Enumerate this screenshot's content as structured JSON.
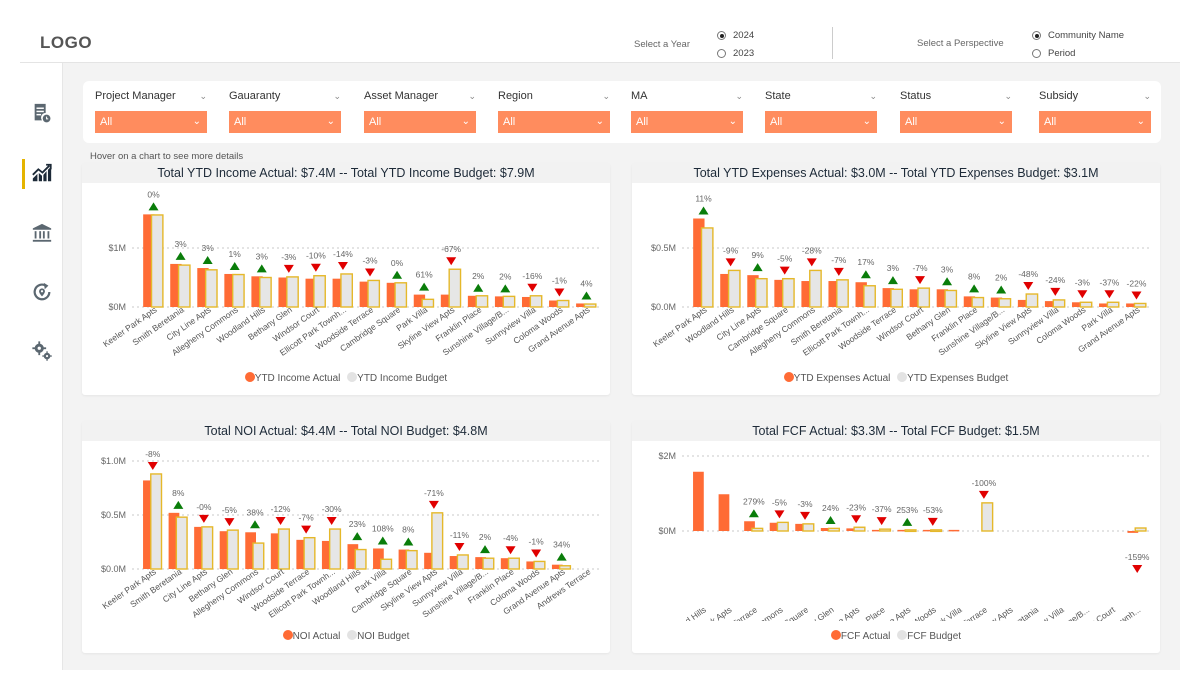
{
  "header": {
    "logo": "LOGO",
    "year_label": "Select a Year",
    "year_options": [
      {
        "label": "2024",
        "selected": true
      },
      {
        "label": "2023",
        "selected": false
      }
    ],
    "perspective_label": "Select a Perspective",
    "perspective_options": [
      {
        "label": "Community Name",
        "selected": true
      },
      {
        "label": "Period",
        "selected": false
      }
    ]
  },
  "sidebar": {
    "items": [
      {
        "icon": "report-icon",
        "active": false
      },
      {
        "icon": "trend-chart-icon",
        "active": true
      },
      {
        "icon": "bank-icon",
        "active": false
      },
      {
        "icon": "refresh-location-icon",
        "active": false
      },
      {
        "icon": "settings-gears-icon",
        "active": false
      }
    ]
  },
  "filters": [
    {
      "label": "Project Manager",
      "value": "All"
    },
    {
      "label": "Gauaranty",
      "value": "All"
    },
    {
      "label": "Asset Manager",
      "value": "All"
    },
    {
      "label": "Region",
      "value": "All"
    },
    {
      "label": "MA",
      "value": "All"
    },
    {
      "label": "State",
      "value": "All"
    },
    {
      "label": "Status",
      "value": "All"
    },
    {
      "label": "Subsidy",
      "value": "All"
    }
  ],
  "hover_hint": "Hover on a chart to see more details",
  "colors": {
    "actual": "#ff6b35",
    "budget_fill": "#e6e6e6",
    "budget_border": "#e5b82a",
    "up": "#0a7d0a",
    "down": "#e00000",
    "filter_bg": "#ff8c5e"
  },
  "chart_data": [
    {
      "type": "bar",
      "title": "Total YTD Income Actual: $7.4M -- Total YTD Income Budget: $7.9M",
      "ylabel": "",
      "xlabel": "",
      "ylim": [
        0,
        1.6
      ],
      "yticks": [
        {
          "v": 0,
          "label": "$0M"
        },
        {
          "v": 1,
          "label": "$1M"
        }
      ],
      "categories": [
        "Keeler Park Apts",
        "Smith Beretania",
        "City Line Apts",
        "Allegheny Commons",
        "Woodland Hills",
        "Bethany Glen",
        "Windsor Court",
        "Ellicott Park Townh...",
        "Woodside Terrace",
        "Cambridge Square",
        "Park Villa",
        "Skyline View Apts",
        "Franklin Place",
        "Sunshine Village/B...",
        "Sunnyview Villa",
        "Coloma Woods",
        "Grand Avenue Apts"
      ],
      "series": [
        {
          "name": "YTD Income Actual",
          "values": [
            1.57,
            0.73,
            0.66,
            0.56,
            0.52,
            0.5,
            0.48,
            0.48,
            0.43,
            0.41,
            0.21,
            0.21,
            0.19,
            0.18,
            0.17,
            0.11,
            0.06
          ]
        },
        {
          "name": "YTD Income Budget",
          "values": [
            1.56,
            0.71,
            0.63,
            0.55,
            0.5,
            0.51,
            0.53,
            0.56,
            0.45,
            0.41,
            0.13,
            0.64,
            0.19,
            0.18,
            0.19,
            0.11,
            0.05
          ]
        }
      ],
      "variance_labels": [
        "0%",
        "3%",
        "3%",
        "1%",
        "3%",
        "-3%",
        "-10%",
        "-14%",
        "-3%",
        "0%",
        "61%",
        "-67%",
        "2%",
        "2%",
        "-16%",
        "-1%",
        "4%"
      ],
      "variance_direction": [
        "up",
        "up",
        "up",
        "up",
        "up",
        "down",
        "down",
        "down",
        "down",
        "up",
        "up",
        "down",
        "up",
        "up",
        "down",
        "down",
        "up"
      ],
      "legend": [
        "YTD Income Actual",
        "YTD Income Budget"
      ],
      "legend_position": "bottom",
      "grid": true
    },
    {
      "type": "bar",
      "title": "Total YTD Expenses Actual: $3.0M -- Total YTD Expenses Budget: $3.1M",
      "ylabel": "",
      "xlabel": "",
      "ylim": [
        0,
        0.8
      ],
      "yticks": [
        {
          "v": 0,
          "label": "$0.0M"
        },
        {
          "v": 0.5,
          "label": "$0.5M"
        }
      ],
      "categories": [
        "Keeler Park Apts",
        "Woodland Hills",
        "City Line Apts",
        "Cambridge Square",
        "Allegheny Commons",
        "Smith Beretania",
        "Ellicott Park Townh...",
        "Woodside Terrace",
        "Windsor Court",
        "Bethany Glen",
        "Franklin Place",
        "Sunshine Village/B...",
        "Skyline View Apts",
        "Sunnyview Villa",
        "Coloma Woods",
        "Park Villa",
        "Grand Avenue Apts"
      ],
      "series": [
        {
          "name": "YTD Expenses Actual",
          "values": [
            0.75,
            0.28,
            0.27,
            0.23,
            0.22,
            0.22,
            0.21,
            0.16,
            0.15,
            0.15,
            0.09,
            0.08,
            0.06,
            0.05,
            0.04,
            0.03,
            0.03
          ]
        },
        {
          "name": "YTD Expenses Budget",
          "values": [
            0.67,
            0.31,
            0.24,
            0.24,
            0.31,
            0.23,
            0.18,
            0.15,
            0.16,
            0.14,
            0.08,
            0.07,
            0.11,
            0.06,
            0.04,
            0.04,
            0.03
          ]
        }
      ],
      "variance_labels": [
        "11%",
        "-9%",
        "9%",
        "-5%",
        "-28%",
        "-7%",
        "17%",
        "3%",
        "-7%",
        "3%",
        "8%",
        "2%",
        "-48%",
        "-24%",
        "-3%",
        "-37%",
        "-22%"
      ],
      "variance_direction": [
        "up",
        "down",
        "up",
        "down",
        "down",
        "down",
        "up",
        "up",
        "down",
        "up",
        "up",
        "up",
        "down",
        "down",
        "down",
        "down",
        "down"
      ],
      "legend": [
        "YTD Expenses Actual",
        "YTD Expenses Budget"
      ],
      "legend_position": "bottom",
      "grid": true
    },
    {
      "type": "bar",
      "title": "Total NOI Actual: $4.4M -- Total NOI Budget: $4.8M",
      "ylabel": "",
      "xlabel": "",
      "ylim": [
        0,
        1.0
      ],
      "yticks": [
        {
          "v": 0,
          "label": "$0.0M"
        },
        {
          "v": 0.5,
          "label": "$0.5M"
        },
        {
          "v": 1.0,
          "label": "$1.0M"
        }
      ],
      "categories": [
        "Keeler Park Apts",
        "Smith Beretania",
        "City Line Apts",
        "Bethany Glen",
        "Allegheny Commons",
        "Windsor Court",
        "Woodside Terrace",
        "Ellicott Park Townh...",
        "Woodland Hills",
        "Park Villa",
        "Cambridge Square",
        "Skyline View Apts",
        "Sunnyview Villa",
        "Sunshine Village/B...",
        "Franklin Place",
        "Coloma Woods",
        "Grand Avenue Apts",
        "Andrews Terrace"
      ],
      "series": [
        {
          "name": "NOI Actual",
          "values": [
            0.82,
            0.52,
            0.39,
            0.35,
            0.34,
            0.33,
            0.27,
            0.26,
            0.23,
            0.19,
            0.18,
            0.15,
            0.12,
            0.11,
            0.1,
            0.07,
            0.04,
            0.0
          ]
        },
        {
          "name": "NOI Budget",
          "values": [
            0.88,
            0.48,
            0.39,
            0.36,
            0.24,
            0.37,
            0.29,
            0.37,
            0.18,
            0.09,
            0.17,
            0.52,
            0.13,
            0.1,
            0.1,
            0.07,
            0.03,
            0.0
          ]
        }
      ],
      "variance_labels": [
        "-8%",
        "8%",
        "-0%",
        "-5%",
        "38%",
        "-12%",
        "-7%",
        "-30%",
        "23%",
        "108%",
        "8%",
        "-71%",
        "-11%",
        "2%",
        "-4%",
        "-1%",
        "34%",
        ""
      ],
      "variance_direction": [
        "down",
        "up",
        "down",
        "down",
        "up",
        "down",
        "down",
        "down",
        "up",
        "up",
        "up",
        "down",
        "down",
        "up",
        "down",
        "down",
        "up",
        ""
      ],
      "legend": [
        "NOI Actual",
        "NOI Budget"
      ],
      "legend_position": "bottom",
      "grid": true
    },
    {
      "type": "bar",
      "title": "Total FCF Actual: $3.3M -- Total FCF Budget: $1.5M",
      "ylabel": "",
      "xlabel": "",
      "ylim": [
        -0.6,
        2.0
      ],
      "yticks": [
        {
          "v": 0,
          "label": "$0M"
        },
        {
          "v": 2,
          "label": "$2M"
        }
      ],
      "categories": [
        "Woodland Hills",
        "Keeler Park Apts",
        "Woodside Terrace",
        "Allegheny Commons",
        "Cambridge Square",
        "Bethany Glen",
        "City Line Apts",
        "Franklin Place",
        "Grand Avenue Apts",
        "Coloma Woods",
        "Park Villa",
        "Andrews Terrace",
        "Skyline View Apts",
        "Smith Beretania",
        "Sunnyview Villa",
        "Sunshine Village/B...",
        "Windsor Court",
        "Ellicott Park Townh..."
      ],
      "series": [
        {
          "name": "FCF Actual",
          "values": [
            1.58,
            0.98,
            0.26,
            0.22,
            0.19,
            0.08,
            0.07,
            0.03,
            0.03,
            0.03,
            0.03,
            0.0,
            0,
            0,
            0,
            0,
            0,
            -0.05
          ]
        },
        {
          "name": "FCF Budget",
          "values": [
            0,
            0,
            0.07,
            0.23,
            0.19,
            0.07,
            0.1,
            0.05,
            0.03,
            0.03,
            0,
            0.75,
            0,
            0,
            0,
            0,
            0,
            0.08
          ]
        }
      ],
      "variance_labels": [
        "",
        "",
        "279%",
        "-5%",
        "-3%",
        "24%",
        "-23%",
        "-37%",
        "253%",
        "-53%",
        "",
        "-100%",
        "",
        "",
        "",
        "",
        "",
        "-159%"
      ],
      "variance_direction": [
        "",
        "",
        "up",
        "down",
        "down",
        "up",
        "down",
        "down",
        "up",
        "down",
        "",
        "down",
        "",
        "",
        "",
        "",
        "",
        "down"
      ],
      "legend": [
        "FCF Actual",
        "FCF Budget"
      ],
      "legend_position": "bottom",
      "grid": true
    }
  ]
}
